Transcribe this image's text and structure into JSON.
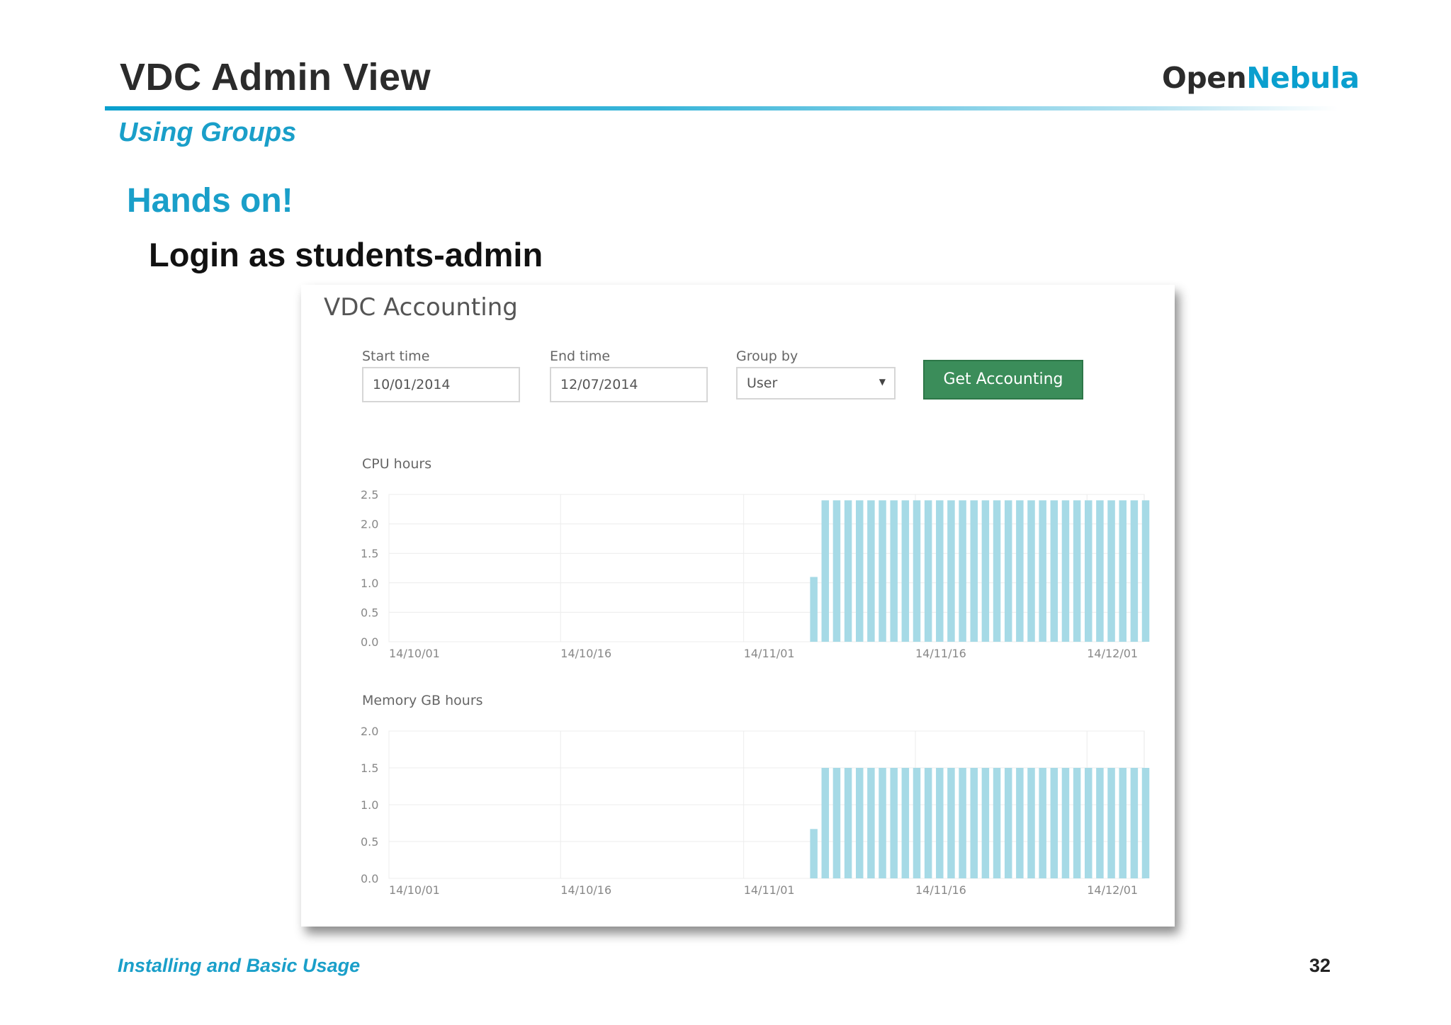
{
  "slide": {
    "title": "VDC Admin View",
    "subtitle": "Using Groups",
    "heading": "Hands on!",
    "instruction": "Login as students-admin",
    "logo": {
      "part1": "Open",
      "part2": "Nebula"
    },
    "footer": "Installing and Basic Usage",
    "page_number": "32"
  },
  "panel": {
    "title": "VDC Accounting",
    "start_time": {
      "label": "Start time",
      "value": "10/01/2014"
    },
    "end_time": {
      "label": "End time",
      "value": "12/07/2014"
    },
    "group_by": {
      "label": "Group by",
      "value": "User"
    },
    "button_label": "Get Accounting"
  },
  "colors": {
    "bar": "#a6dae6",
    "button": "#3b8d5a",
    "accent": "#1a9fc9"
  },
  "chart_data": [
    {
      "type": "bar",
      "title": "CPU hours",
      "x": [
        "14/10/01",
        "14/10/16",
        "14/11/01",
        "14/11/16",
        "14/12/01"
      ],
      "x_start_day": 0,
      "x_end_day": 66,
      "ylim": [
        0,
        2.5
      ],
      "yticks": [
        "0.0",
        "0.5",
        "1.0",
        "1.5",
        "2.0",
        "2.5"
      ],
      "bars": [
        {
          "day": 36.8,
          "value": 1.1
        },
        {
          "day": 37.8,
          "value": 2.4
        },
        {
          "day": 38.8,
          "value": 2.4
        },
        {
          "day": 39.8,
          "value": 2.4
        },
        {
          "day": 40.8,
          "value": 2.4
        },
        {
          "day": 41.8,
          "value": 2.4
        },
        {
          "day": 42.8,
          "value": 2.4
        },
        {
          "day": 43.8,
          "value": 2.4
        },
        {
          "day": 44.8,
          "value": 2.4
        },
        {
          "day": 45.8,
          "value": 2.4
        },
        {
          "day": 46.8,
          "value": 2.4
        },
        {
          "day": 47.8,
          "value": 2.4
        },
        {
          "day": 48.8,
          "value": 2.4
        },
        {
          "day": 49.8,
          "value": 2.4
        },
        {
          "day": 50.8,
          "value": 2.4
        },
        {
          "day": 51.8,
          "value": 2.4
        },
        {
          "day": 52.8,
          "value": 2.4
        },
        {
          "day": 53.8,
          "value": 2.4
        },
        {
          "day": 54.8,
          "value": 2.4
        },
        {
          "day": 55.8,
          "value": 2.4
        },
        {
          "day": 56.8,
          "value": 2.4
        },
        {
          "day": 57.8,
          "value": 2.4
        },
        {
          "day": 58.8,
          "value": 2.4
        },
        {
          "day": 59.8,
          "value": 2.4
        },
        {
          "day": 60.8,
          "value": 2.4
        },
        {
          "day": 61.8,
          "value": 2.4
        },
        {
          "day": 62.8,
          "value": 2.4
        },
        {
          "day": 63.8,
          "value": 2.4
        },
        {
          "day": 64.8,
          "value": 2.4
        },
        {
          "day": 65.8,
          "value": 2.4
        }
      ]
    },
    {
      "type": "bar",
      "title": "Memory GB hours",
      "x": [
        "14/10/01",
        "14/10/16",
        "14/11/01",
        "14/11/16",
        "14/12/01"
      ],
      "x_start_day": 0,
      "x_end_day": 66,
      "ylim": [
        0,
        2.0
      ],
      "yticks": [
        "0.0",
        "0.5",
        "1.0",
        "1.5",
        "2.0"
      ],
      "bars": [
        {
          "day": 36.8,
          "value": 0.67
        },
        {
          "day": 37.8,
          "value": 1.5
        },
        {
          "day": 38.8,
          "value": 1.5
        },
        {
          "day": 39.8,
          "value": 1.5
        },
        {
          "day": 40.8,
          "value": 1.5
        },
        {
          "day": 41.8,
          "value": 1.5
        },
        {
          "day": 42.8,
          "value": 1.5
        },
        {
          "day": 43.8,
          "value": 1.5
        },
        {
          "day": 44.8,
          "value": 1.5
        },
        {
          "day": 45.8,
          "value": 1.5
        },
        {
          "day": 46.8,
          "value": 1.5
        },
        {
          "day": 47.8,
          "value": 1.5
        },
        {
          "day": 48.8,
          "value": 1.5
        },
        {
          "day": 49.8,
          "value": 1.5
        },
        {
          "day": 50.8,
          "value": 1.5
        },
        {
          "day": 51.8,
          "value": 1.5
        },
        {
          "day": 52.8,
          "value": 1.5
        },
        {
          "day": 53.8,
          "value": 1.5
        },
        {
          "day": 54.8,
          "value": 1.5
        },
        {
          "day": 55.8,
          "value": 1.5
        },
        {
          "day": 56.8,
          "value": 1.5
        },
        {
          "day": 57.8,
          "value": 1.5
        },
        {
          "day": 58.8,
          "value": 1.5
        },
        {
          "day": 59.8,
          "value": 1.5
        },
        {
          "day": 60.8,
          "value": 1.5
        },
        {
          "day": 61.8,
          "value": 1.5
        },
        {
          "day": 62.8,
          "value": 1.5
        },
        {
          "day": 63.8,
          "value": 1.5
        },
        {
          "day": 64.8,
          "value": 1.5
        },
        {
          "day": 65.8,
          "value": 1.5
        }
      ]
    }
  ]
}
